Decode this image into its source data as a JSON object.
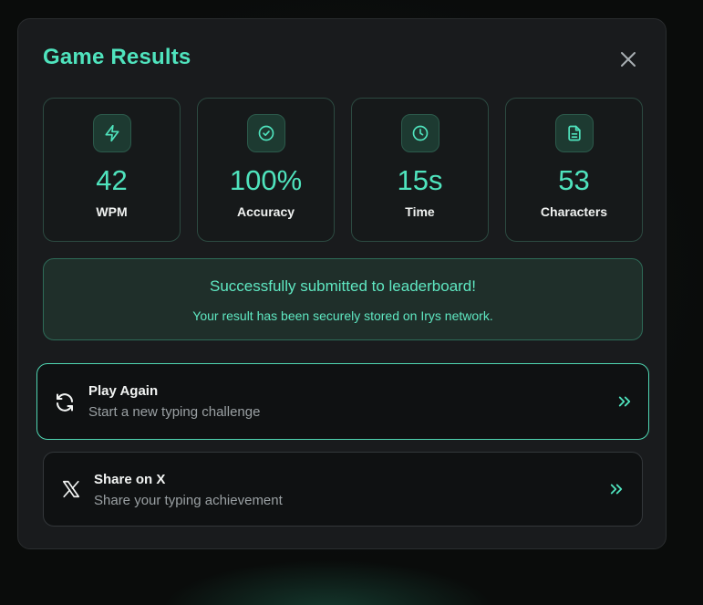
{
  "modal": {
    "title": "Game Results"
  },
  "stats": [
    {
      "icon": "lightning-icon",
      "value": "42",
      "label": "WPM"
    },
    {
      "icon": "check-circle-icon",
      "value": "100%",
      "label": "Accuracy"
    },
    {
      "icon": "clock-icon",
      "value": "15s",
      "label": "Time"
    },
    {
      "icon": "document-icon",
      "value": "53",
      "label": "Characters"
    }
  ],
  "submission": {
    "title": "Successfully submitted to leaderboard!",
    "subtitle": "Your result has been securely stored on Irys network."
  },
  "actions": {
    "play_again": {
      "icon": "refresh-icon",
      "title": "Play Again",
      "subtitle": "Start a new typing challenge"
    },
    "share": {
      "icon": "x-logo-icon",
      "title": "Share on X",
      "subtitle": "Share your typing achievement"
    }
  },
  "colors": {
    "accent": "#4fe3bd",
    "panel": "#191b1d",
    "success_bg": "#1f2f2a",
    "text": "#f2f4f3",
    "muted": "#9aa0a3"
  }
}
